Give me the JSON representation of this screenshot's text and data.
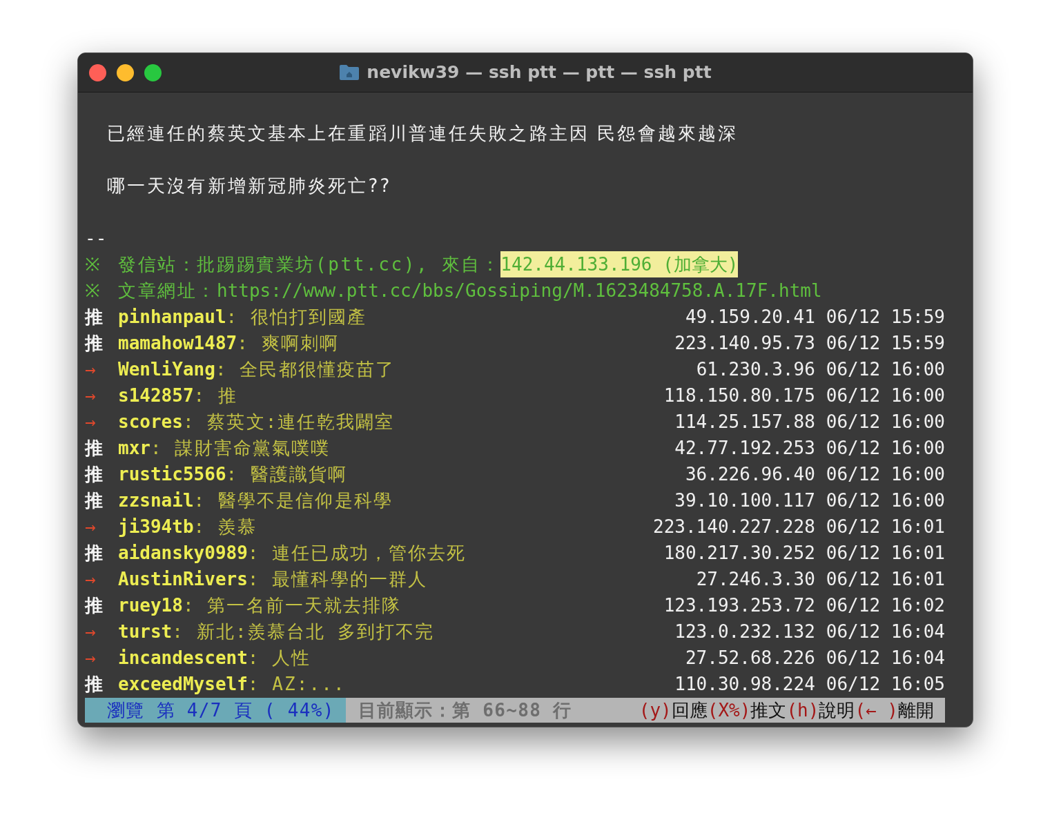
{
  "window": {
    "title": "nevikw39 — ssh ptt — ptt — ssh ptt"
  },
  "body_lines": [
    "已經連任的蔡英文基本上在重蹈川普連任失敗之路主因 民怨會越來越深",
    "哪一天沒有新增新冠肺炎死亡??"
  ],
  "signature": "--",
  "footer_lines": [
    {
      "mark": "※",
      "label": "發信站：批踢踢實業坊(ptt.cc), 來自：",
      "value": "142.44.133.196 (加拿大)",
      "highlighted": true
    },
    {
      "mark": "※",
      "label": "文章網址：",
      "value": "https://www.ptt.cc/bbs/Gossiping/M.1623484758.A.17F.html",
      "highlighted": false
    }
  ],
  "comments": [
    {
      "kind": "push",
      "tag": "推",
      "user": "pinhanpaul",
      "text": ": 很怕打到國產",
      "ip": "49.159.20.41",
      "time": "06/12 15:59"
    },
    {
      "kind": "push",
      "tag": "推",
      "user": "mamahow1487",
      "text": ": 爽啊刺啊",
      "ip": "223.140.95.73",
      "time": "06/12 15:59"
    },
    {
      "kind": "arrow",
      "tag": "→",
      "user": "WenliYang",
      "text": ": 全民都很懂疫苗了",
      "ip": "61.230.3.96",
      "time": "06/12 16:00"
    },
    {
      "kind": "arrow",
      "tag": "→",
      "user": "s142857",
      "text": ": 推",
      "ip": "118.150.80.175",
      "time": "06/12 16:00"
    },
    {
      "kind": "arrow",
      "tag": "→",
      "user": "scores",
      "text": ": 蔡英文:連任乾我闢室",
      "ip": "114.25.157.88",
      "time": "06/12 16:00"
    },
    {
      "kind": "push",
      "tag": "推",
      "user": "mxr",
      "text": ": 謀財害命黨氣噗噗",
      "ip": "42.77.192.253",
      "time": "06/12 16:00"
    },
    {
      "kind": "push",
      "tag": "推",
      "user": "rustic5566",
      "text": ": 醫護識貨啊",
      "ip": "36.226.96.40",
      "time": "06/12 16:00"
    },
    {
      "kind": "push",
      "tag": "推",
      "user": "zzsnail",
      "text": ": 醫學不是信仰是科學",
      "ip": "39.10.100.117",
      "time": "06/12 16:00"
    },
    {
      "kind": "arrow",
      "tag": "→",
      "user": "ji394tb",
      "text": ": 羨慕",
      "ip": "223.140.227.228",
      "time": "06/12 16:01"
    },
    {
      "kind": "push",
      "tag": "推",
      "user": "aidansky0989",
      "text": ": 連任已成功，管你去死",
      "ip": "180.217.30.252",
      "time": "06/12 16:01"
    },
    {
      "kind": "arrow",
      "tag": "→",
      "user": "AustinRivers",
      "text": ": 最懂科學的一群人",
      "ip": "27.246.3.30",
      "time": "06/12 16:01"
    },
    {
      "kind": "push",
      "tag": "推",
      "user": "ruey18",
      "text": ": 第一名前一天就去排隊",
      "ip": "123.193.253.72",
      "time": "06/12 16:02"
    },
    {
      "kind": "arrow",
      "tag": "→",
      "user": "turst",
      "text": ": 新北:羨慕台北 多到打不完",
      "ip": "123.0.232.132",
      "time": "06/12 16:04"
    },
    {
      "kind": "arrow",
      "tag": "→",
      "user": "incandescent",
      "text": ": 人性",
      "ip": "27.52.68.226",
      "time": "06/12 16:04"
    },
    {
      "kind": "push",
      "tag": "推",
      "user": "exceedMyself",
      "text": ": AZ:...",
      "ip": "110.30.98.224",
      "time": "06/12 16:05"
    }
  ],
  "status_bar": {
    "page": "瀏覽 第 4/7 頁 ( 44%)",
    "range": "目前顯示：第 66~88 行",
    "hints": [
      {
        "key": "(y)",
        "label": "回應"
      },
      {
        "key": "(X%)",
        "label": "推文"
      },
      {
        "key": "(h)",
        "label": "說明"
      },
      {
        "key": "(← )",
        "label": "離開"
      }
    ]
  }
}
